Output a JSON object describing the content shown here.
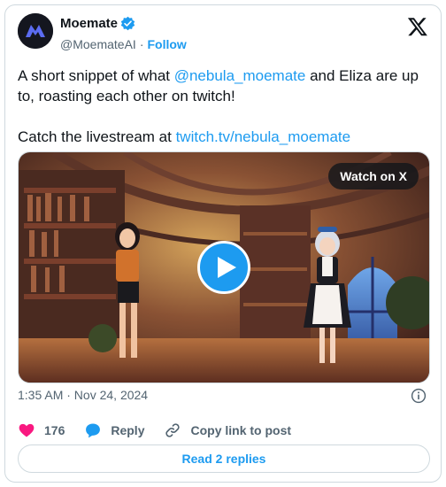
{
  "author": {
    "display_name": "Moemate",
    "handle": "@MoemateAI",
    "separator": "·",
    "follow_label": "Follow"
  },
  "tweet": {
    "line1_pre": "A short snippet of what ",
    "line1_mention": "@nebula_moemate",
    "line1_post": " and Eliza are up to, roasting each other on twitch!",
    "line2_pre": "Catch the livestream at ",
    "line2_link": "twitch.tv/nebula_moemate"
  },
  "media": {
    "watch_label": "Watch on X"
  },
  "meta": {
    "timestamp": "1:35 AM · Nov 24, 2024"
  },
  "actions": {
    "like_count": "176",
    "reply_label": "Reply",
    "copy_label": "Copy link to post",
    "replies_label": "Read 2 replies"
  },
  "colors": {
    "accent": "#1d9bf0",
    "like": "#f91880",
    "text": "#0f1419",
    "muted": "#536471"
  }
}
